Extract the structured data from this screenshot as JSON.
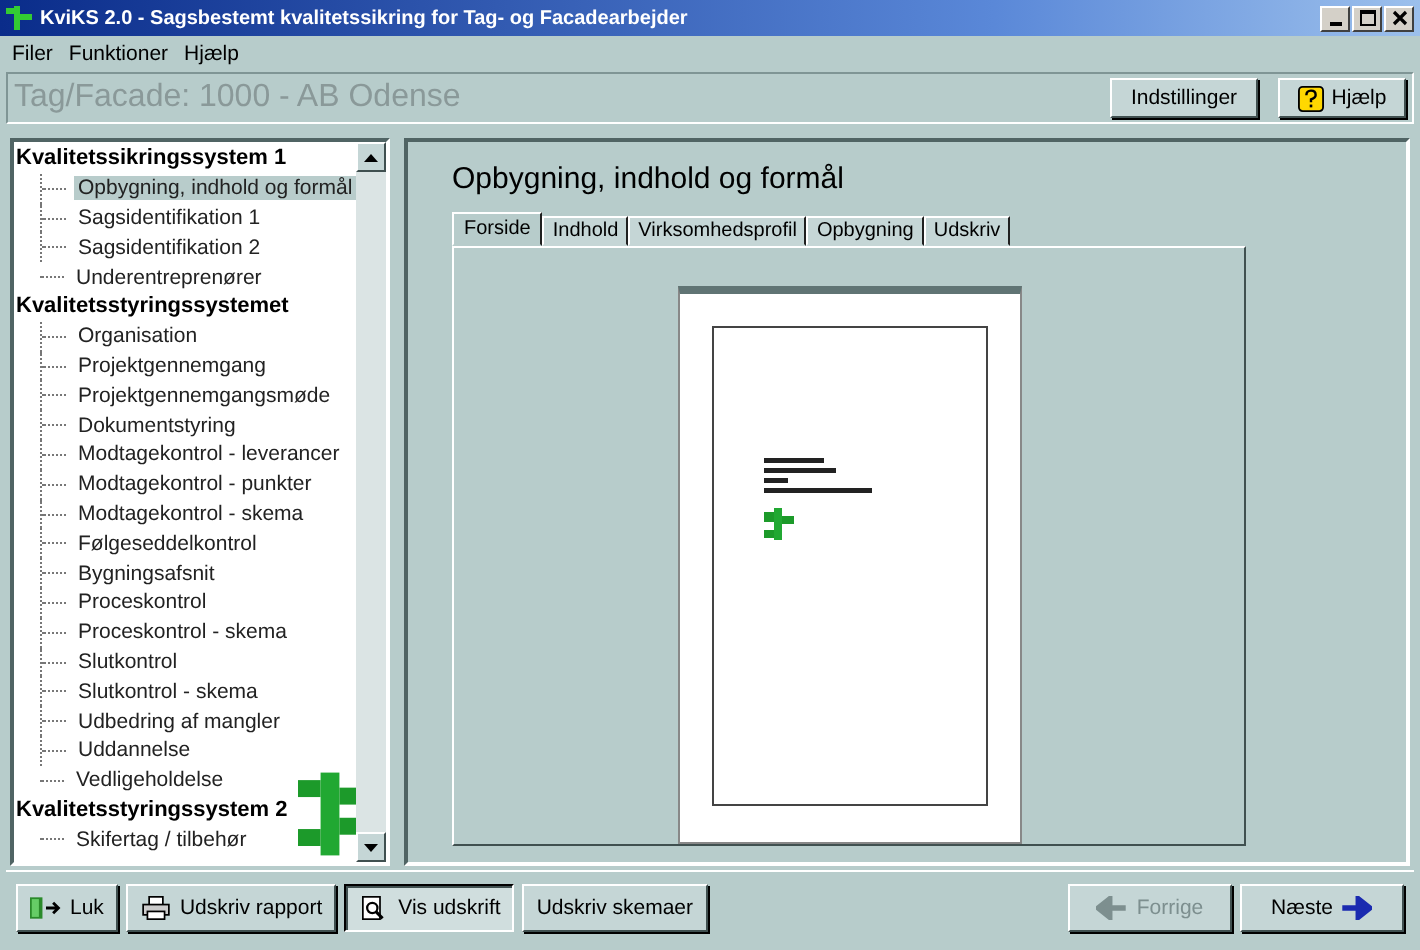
{
  "window": {
    "title": "KviKS 2.0 - Sagsbestemt kvalitetssikring for Tag- og Facadearbejder"
  },
  "menu": [
    "Filer",
    "Funktioner",
    "Hjælp"
  ],
  "header": {
    "caption": "Tag/Facade: 1000 - AB Odense",
    "buttons": [
      {
        "label": "Indstillinger",
        "kind": "plain"
      },
      {
        "label": "Hjælp",
        "kind": "help"
      }
    ]
  },
  "tree": [
    {
      "label": "Kvalitetssikringssystem 1",
      "children": [
        {
          "label": "Opbygning, indhold og formål",
          "selected": true
        },
        {
          "label": "Sagsidentifikation 1",
          "selected": false
        },
        {
          "label": "Sagsidentifikation 2",
          "selected": false
        },
        {
          "label": "Underentreprenører",
          "selected": false
        }
      ]
    },
    {
      "label": "Kvalitetsstyringssystemet",
      "children": [
        {
          "label": "Organisation",
          "selected": false
        },
        {
          "label": "Projektgennemgang",
          "selected": false
        },
        {
          "label": "Projektgennemgangsmøde",
          "selected": false
        },
        {
          "label": "Dokumentstyring",
          "selected": false
        },
        {
          "label": "Modtagekontrol - leverancer",
          "selected": false
        },
        {
          "label": "Modtagekontrol - punkter",
          "selected": false
        },
        {
          "label": "Modtagekontrol - skema",
          "selected": false
        },
        {
          "label": "Følgeseddelkontrol",
          "selected": false
        },
        {
          "label": "Bygningsafsnit",
          "selected": false
        },
        {
          "label": "Proceskontrol",
          "selected": false
        },
        {
          "label": "Proceskontrol - skema",
          "selected": false
        },
        {
          "label": "Slutkontrol",
          "selected": false
        },
        {
          "label": "Slutkontrol - skema",
          "selected": false
        },
        {
          "label": "Udbedring af mangler",
          "selected": false
        },
        {
          "label": "Uddannelse",
          "selected": false
        },
        {
          "label": "Vedligeholdelse",
          "selected": false
        }
      ]
    },
    {
      "label": "Kvalitetsstyringssystem 2",
      "children": [
        {
          "label": "Skifertag / tilbehør",
          "selected": false
        }
      ]
    }
  ],
  "page": {
    "heading": "Opbygning, indhold og formål",
    "tabs": [
      {
        "label": "Forside",
        "selected": true
      },
      {
        "label": "Indhold",
        "selected": false
      },
      {
        "label": "Virksomhedsprofil",
        "selected": false
      },
      {
        "label": "Opbygning",
        "selected": false
      },
      {
        "label": "Udskriv",
        "selected": false
      }
    ]
  },
  "footer": {
    "left_buttons": [
      {
        "label": "Luk",
        "kind": "exit",
        "pressed": false,
        "disabled": false
      },
      {
        "label": "Udskriv rapport",
        "kind": "print",
        "pressed": false,
        "disabled": false
      },
      {
        "label": "Vis udskrift",
        "kind": "preview",
        "pressed": true,
        "disabled": false
      },
      {
        "label": "Udskriv skemaer",
        "kind": "plain",
        "pressed": false,
        "disabled": false
      }
    ],
    "right_buttons": [
      {
        "label": "Forrige",
        "kind": "back",
        "pressed": false,
        "disabled": true
      },
      {
        "label": "Næste",
        "kind": "next",
        "pressed": false,
        "disabled": false
      }
    ]
  }
}
